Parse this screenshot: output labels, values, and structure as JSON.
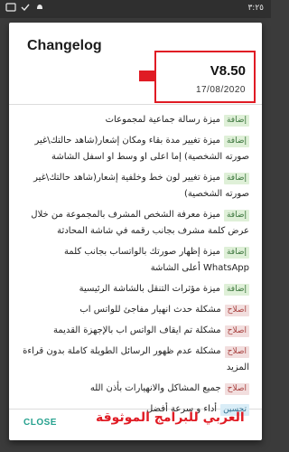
{
  "status_bar": {
    "time": "٣:٢٥"
  },
  "dialog": {
    "title": "Changelog",
    "version": "V8.50",
    "date": "17/08/2020",
    "close_label": "CLOSE"
  },
  "tags": {
    "add": "إضافة",
    "fix": "اصلاح",
    "improve": "تحسين"
  },
  "changelog": [
    {
      "type": "add",
      "text": "ميزة رسالة جماعية لمجموعات"
    },
    {
      "type": "add",
      "text": "ميزة تغيير مدة بقاء ومكان إشعار(شاهد حالتك\\غير صورته الشخصية) إما اعلى او وسط او اسفل الشاشة"
    },
    {
      "type": "add",
      "text": "ميزة تغيير لون خط وخلفية إشعار(شاهد حالتك\\غير صورته الشخصية)"
    },
    {
      "type": "add",
      "text": "ميزة معرفة الشخص المشرف بالمجموعة من خلال عرض كلمة مشرف بجانب رقمه في شاشة المحادثة"
    },
    {
      "type": "add",
      "text": "ميزة إظهار صورتك بالواتساب بجانب كلمة WhatsApp أعلى الشاشة"
    },
    {
      "type": "add",
      "text": "ميزة مؤثرات التنقل بالشاشة الرئيسية"
    },
    {
      "type": "fix",
      "text": "مشكلة حدث انهيار مفاجئ للواتس اب"
    },
    {
      "type": "fix",
      "text": "مشكلة تم ايقاف الواتس اب بالإجهزة القديمة"
    },
    {
      "type": "fix",
      "text": "مشكلة عدم ظهور الرسائل الطويلة كاملة بدون قراءة المزيد"
    },
    {
      "type": "fix",
      "text": "جميع المشاكل والانهيارات بأذن الله"
    },
    {
      "type": "improve",
      "text": "أداء و سرعة أفضل"
    }
  ],
  "watermark": "العربي للبرامج الموثوقة",
  "colors": {
    "accent": "#25a18e",
    "highlight": "#e01b24",
    "dialog_bg": "#ffffff",
    "backdrop": "#3b3b3b"
  }
}
